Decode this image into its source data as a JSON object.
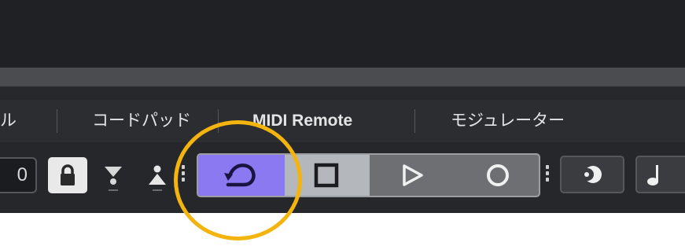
{
  "tabs": {
    "partial_left": "ル",
    "chord_pads": "コードパッド",
    "midi_remote": "MIDI Remote",
    "modulators": "モジュレーター"
  },
  "toolbar": {
    "number_value": "0",
    "lock_icon": "lock-icon",
    "marker_icons": [
      "hourglass-down-icon",
      "person-up-icon"
    ]
  },
  "transport": {
    "cycle_icon": "cycle-icon",
    "stop_icon": "stop-icon",
    "play_icon": "play-icon",
    "record_icon": "record-icon",
    "cycle_active": true
  },
  "right_buttons": [
    "moon-icon",
    "note-icon"
  ],
  "colors": {
    "cycle_active": "#8a79f0",
    "stop_bg": "#b4b7bb",
    "transport_bg": "#6d6f73",
    "highlight_ring": "#f4b40f",
    "panel_bg": "#25272a"
  }
}
